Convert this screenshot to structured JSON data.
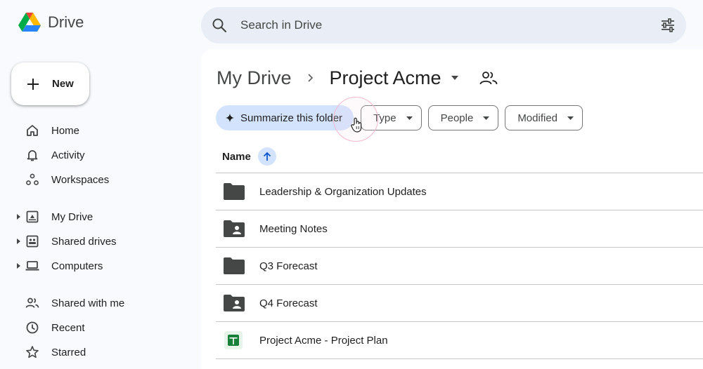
{
  "app": {
    "name": "Drive"
  },
  "search": {
    "placeholder": "Search in Drive"
  },
  "sidebar": {
    "new_label": "New",
    "items": [
      {
        "label": "Home"
      },
      {
        "label": "Activity"
      },
      {
        "label": "Workspaces"
      },
      {
        "label": "My Drive"
      },
      {
        "label": "Shared drives"
      },
      {
        "label": "Computers"
      },
      {
        "label": "Shared with me"
      },
      {
        "label": "Recent"
      },
      {
        "label": "Starred"
      }
    ]
  },
  "breadcrumb": {
    "root": "My Drive",
    "current": "Project Acme"
  },
  "chips": {
    "summarize": "Summarize this folder",
    "type": "Type",
    "people": "People",
    "modified": "Modified"
  },
  "list": {
    "column_name": "Name",
    "rows": [
      {
        "name": "Leadership & Organization Updates",
        "icon": "folder-icon"
      },
      {
        "name": "Meeting Notes",
        "icon": "shared-folder-icon"
      },
      {
        "name": "Q3 Forecast",
        "icon": "folder-icon"
      },
      {
        "name": "Q4 Forecast",
        "icon": "shared-folder-icon"
      },
      {
        "name": "Project Acme - Project Plan",
        "icon": "sheets-icon"
      }
    ]
  },
  "colors": {
    "accent": "#d3e3fd",
    "folder": "#444746",
    "sheets": "#188038"
  }
}
